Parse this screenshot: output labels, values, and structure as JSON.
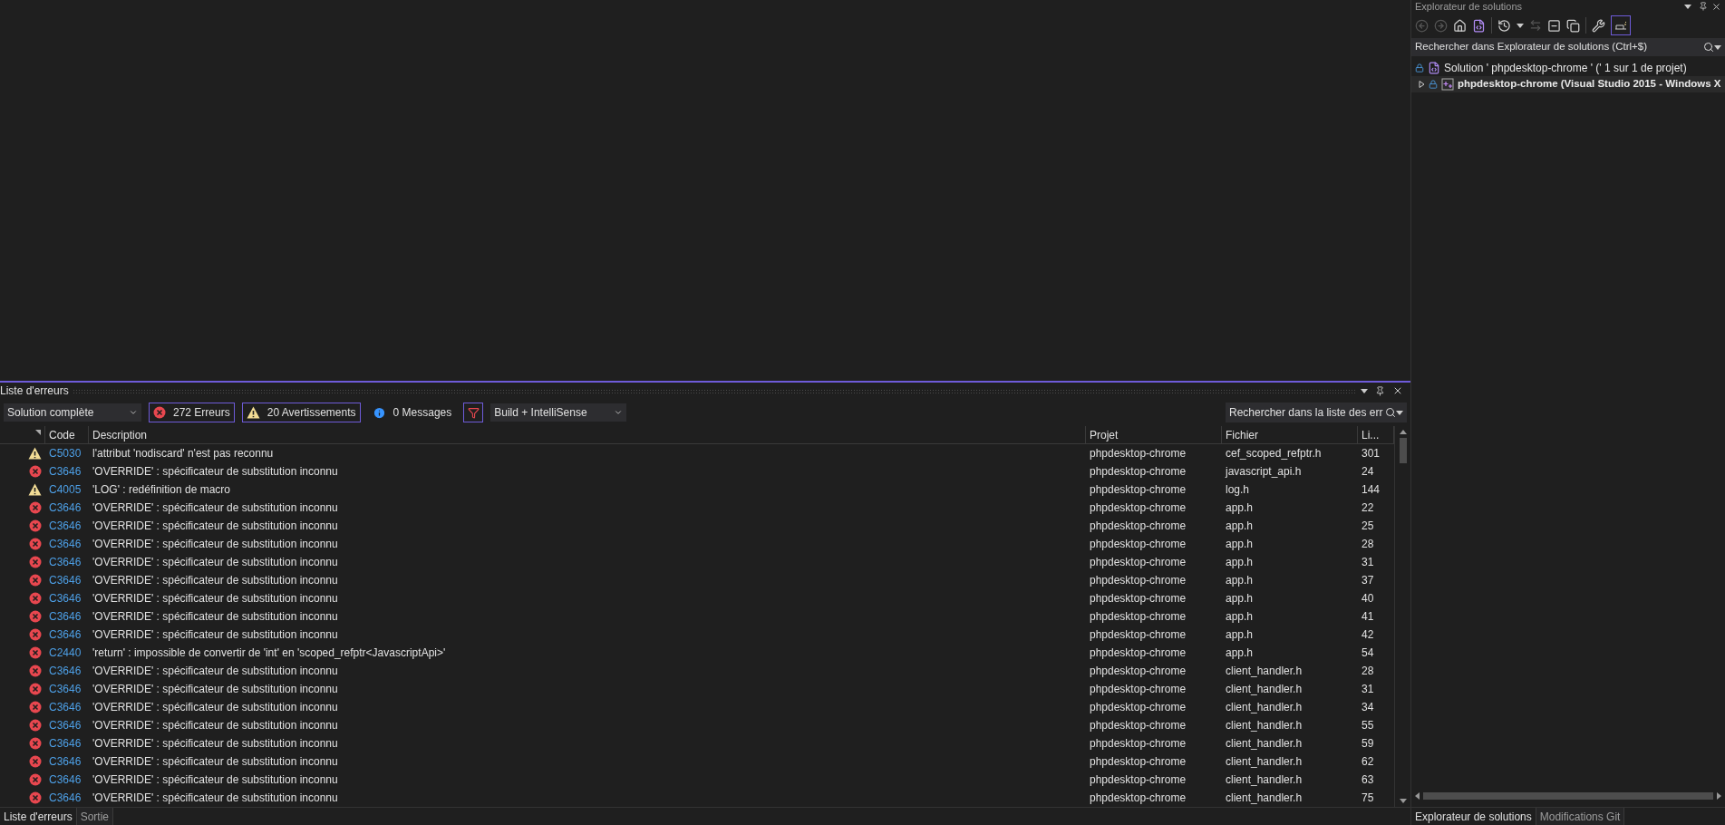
{
  "error_list": {
    "title": "Liste d'erreurs",
    "scope": "Solution complète",
    "filters": [
      {
        "kind": "error",
        "label": "272 Erreurs",
        "selected": true
      },
      {
        "kind": "warning",
        "label": "20 Avertissements",
        "selected": true
      },
      {
        "kind": "message",
        "label": "0 Messages",
        "selected": false
      }
    ],
    "filter_toggle": {
      "selected": true
    },
    "source": "Build + IntelliSense",
    "search": {
      "placeholder": "Rechercher dans la liste des err"
    },
    "columns": [
      "Code",
      "Description",
      "Projet",
      "Fichier",
      "Li..."
    ],
    "rows": [
      {
        "kind": "warning",
        "code": "C5030",
        "description": "l'attribut 'nodiscard' n'est pas reconnu",
        "project": "phpdesktop-chrome",
        "file": "cef_scoped_refptr.h",
        "line": "301"
      },
      {
        "kind": "error",
        "code": "C3646",
        "description": "'OVERRIDE' : spécificateur de substitution inconnu",
        "project": "phpdesktop-chrome",
        "file": "javascript_api.h",
        "line": "24"
      },
      {
        "kind": "warning",
        "code": "C4005",
        "description": "'LOG' : redéfinition de macro",
        "project": "phpdesktop-chrome",
        "file": "log.h",
        "line": "144"
      },
      {
        "kind": "error",
        "code": "C3646",
        "description": "'OVERRIDE' : spécificateur de substitution inconnu",
        "project": "phpdesktop-chrome",
        "file": "app.h",
        "line": "22"
      },
      {
        "kind": "error",
        "code": "C3646",
        "description": "'OVERRIDE' : spécificateur de substitution inconnu",
        "project": "phpdesktop-chrome",
        "file": "app.h",
        "line": "25"
      },
      {
        "kind": "error",
        "code": "C3646",
        "description": "'OVERRIDE' : spécificateur de substitution inconnu",
        "project": "phpdesktop-chrome",
        "file": "app.h",
        "line": "28"
      },
      {
        "kind": "error",
        "code": "C3646",
        "description": "'OVERRIDE' : spécificateur de substitution inconnu",
        "project": "phpdesktop-chrome",
        "file": "app.h",
        "line": "31"
      },
      {
        "kind": "error",
        "code": "C3646",
        "description": "'OVERRIDE' : spécificateur de substitution inconnu",
        "project": "phpdesktop-chrome",
        "file": "app.h",
        "line": "37"
      },
      {
        "kind": "error",
        "code": "C3646",
        "description": "'OVERRIDE' : spécificateur de substitution inconnu",
        "project": "phpdesktop-chrome",
        "file": "app.h",
        "line": "40"
      },
      {
        "kind": "error",
        "code": "C3646",
        "description": "'OVERRIDE' : spécificateur de substitution inconnu",
        "project": "phpdesktop-chrome",
        "file": "app.h",
        "line": "41"
      },
      {
        "kind": "error",
        "code": "C3646",
        "description": "'OVERRIDE' : spécificateur de substitution inconnu",
        "project": "phpdesktop-chrome",
        "file": "app.h",
        "line": "42"
      },
      {
        "kind": "error",
        "code": "C2440",
        "description": "'return' : impossible de convertir de 'int' en 'scoped_refptr<JavascriptApi>'",
        "project": "phpdesktop-chrome",
        "file": "app.h",
        "line": "54"
      },
      {
        "kind": "error",
        "code": "C3646",
        "description": "'OVERRIDE' : spécificateur de substitution inconnu",
        "project": "phpdesktop-chrome",
        "file": "client_handler.h",
        "line": "28"
      },
      {
        "kind": "error",
        "code": "C3646",
        "description": "'OVERRIDE' : spécificateur de substitution inconnu",
        "project": "phpdesktop-chrome",
        "file": "client_handler.h",
        "line": "31"
      },
      {
        "kind": "error",
        "code": "C3646",
        "description": "'OVERRIDE' : spécificateur de substitution inconnu",
        "project": "phpdesktop-chrome",
        "file": "client_handler.h",
        "line": "34"
      },
      {
        "kind": "error",
        "code": "C3646",
        "description": "'OVERRIDE' : spécificateur de substitution inconnu",
        "project": "phpdesktop-chrome",
        "file": "client_handler.h",
        "line": "55"
      },
      {
        "kind": "error",
        "code": "C3646",
        "description": "'OVERRIDE' : spécificateur de substitution inconnu",
        "project": "phpdesktop-chrome",
        "file": "client_handler.h",
        "line": "59"
      },
      {
        "kind": "error",
        "code": "C3646",
        "description": "'OVERRIDE' : spécificateur de substitution inconnu",
        "project": "phpdesktop-chrome",
        "file": "client_handler.h",
        "line": "62"
      },
      {
        "kind": "error",
        "code": "C3646",
        "description": "'OVERRIDE' : spécificateur de substitution inconnu",
        "project": "phpdesktop-chrome",
        "file": "client_handler.h",
        "line": "63"
      },
      {
        "kind": "error",
        "code": "C3646",
        "description": "'OVERRIDE' : spécificateur de substitution inconnu",
        "project": "phpdesktop-chrome",
        "file": "client_handler.h",
        "line": "75"
      }
    ]
  },
  "bottom_tabs_left": [
    {
      "label": "Liste d'erreurs",
      "selected": true
    },
    {
      "label": "Sortie",
      "selected": false
    }
  ],
  "solution_explorer": {
    "title": "Explorateur de solutions",
    "search": {
      "placeholder": "Rechercher dans Explorateur de solutions (Ctrl+$)"
    },
    "tree": [
      {
        "label": "Solution ' phpdesktop-chrome ' (' 1 sur 1 de projet)",
        "children": [
          {
            "label": "phpdesktop-chrome (Visual Studio 2015 - Windows X",
            "expanded": false
          }
        ]
      }
    ]
  },
  "bottom_tabs_right": [
    {
      "label": "Explorateur de solutions",
      "selected": true
    },
    {
      "label": "Modifications Git",
      "selected": false
    }
  ]
}
